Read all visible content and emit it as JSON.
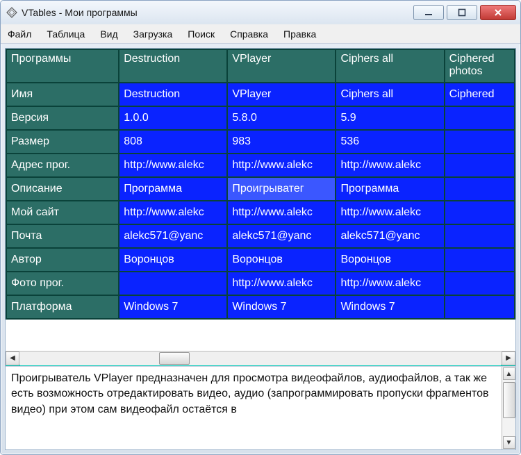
{
  "window": {
    "title": "VTables - Мои программы"
  },
  "menu": {
    "items": [
      "Файл",
      "Таблица",
      "Вид",
      "Загрузка",
      "Поиск",
      "Справка",
      "Правка"
    ]
  },
  "grid": {
    "corner_header": "Программы",
    "column_headers": [
      "Destruction",
      "VPlayer",
      "Ciphers all",
      "Ciphered photos"
    ],
    "row_headers": [
      "Имя",
      "Версия",
      "Размер",
      "Адрес прог.",
      "Описание",
      "Мой сайт",
      "Почта",
      "Автор",
      "Фото прог.",
      "Платформа"
    ],
    "rows": [
      [
        "Destruction",
        "VPlayer",
        "Ciphers all",
        "Ciphered"
      ],
      [
        "1.0.0",
        "5.8.0",
        "5.9",
        ""
      ],
      [
        "808",
        "983",
        "536",
        ""
      ],
      [
        "http://www.alekc",
        "http://www.alekc",
        "http://www.alekc",
        ""
      ],
      [
        "Программа",
        "Проигрыватег",
        "Программа",
        ""
      ],
      [
        "http://www.alekc",
        "http://www.alekc",
        "http://www.alekc",
        ""
      ],
      [
        "alekc571@yanc",
        "alekc571@yanc",
        "alekc571@yanc",
        ""
      ],
      [
        "Воронцов",
        "Воронцов",
        "Воронцов",
        ""
      ],
      [
        "",
        "http://www.alekc",
        "http://www.alekc",
        ""
      ],
      [
        "Windows 7",
        "Windows 7",
        "Windows 7",
        ""
      ]
    ],
    "selected": {
      "row": 4,
      "col": 1
    }
  },
  "description": "Проигрыватель VPlayer предназначен для  просмотра видеофайлов, аудиофайлов, а так же есть возможность отредактировать видео, аудио (запрограммировать пропуски фрагментов видео) при этом сам видеофайл остаётся в"
}
